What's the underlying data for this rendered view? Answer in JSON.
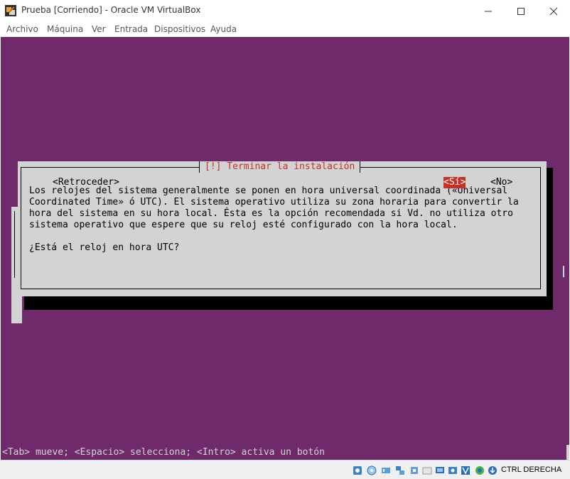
{
  "window": {
    "title": "Prueba [Corriendo] - Oracle VM VirtualBox"
  },
  "menu": [
    "Archivo",
    "Máquina",
    "Ver",
    "Entrada",
    "Dispositivos",
    "Ayuda"
  ],
  "installer": {
    "dialog_title": "[!] Terminar la instalación",
    "body_lines": [
      "Los relojes del sistema generalmente se ponen en hora universal coordinada («Universal",
      "Coordinated Time» ó UTC). El sistema operativo utiliza su zona horaria para convertir la",
      "hora del sistema en su hora local. Ésta es la opción recomendada si Vd. no utiliza otro",
      "sistema operativo que espere que su reloj esté configurado con la hora local."
    ],
    "question": "¿Está el reloj en hora UTC?",
    "buttons": {
      "back": "<Retroceder>",
      "yes": "<Sí>",
      "no": "<No>"
    },
    "status_line": "<Tab> mueve; <Espacio> selecciona; <Intro> activa un botón"
  },
  "statusbar": {
    "host_key": "CTRL DERECHA",
    "icons": [
      "hard-disk-icon",
      "optical-drive-icon",
      "audio-icon",
      "network-icon",
      "usb-icon",
      "shared-folders-icon",
      "display-icon",
      "video-capture-icon",
      "virtualization-icon",
      "mouse-integration-icon",
      "keyboard-capture-icon"
    ]
  },
  "colors": {
    "vm_background": "#6f2a6c",
    "dialog": "#d3d3d3",
    "accent_red": "#c6302a"
  }
}
